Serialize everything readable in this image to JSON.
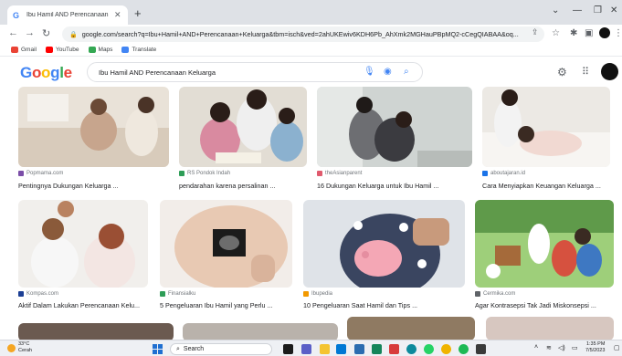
{
  "browser": {
    "tab_title": "Ibu Hamil AND Perencanaan Kel",
    "tab_favicon": "G",
    "new_tab": "+",
    "url": "google.com/search?q=Ibu+Hamil+AND+Perencanaan+Keluarga&tbm=isch&ved=2ahUKEwiv6KDH6Pb_AhXmk2MGHauPBpMQ2-cCegQIABAA&oq...",
    "bookmarks": [
      {
        "label": "Gmail",
        "icon": "gmail-icon",
        "color": "#ea4335"
      },
      {
        "label": "YouTube",
        "icon": "youtube-icon",
        "color": "#ff0000"
      },
      {
        "label": "Maps",
        "icon": "maps-icon",
        "color": "#34a853"
      },
      {
        "label": "Translate",
        "icon": "translate-icon",
        "color": "#4285f4"
      }
    ]
  },
  "google": {
    "logo": "Google",
    "query": "Ibu Hamil AND Perencanaan Keluarga",
    "colors": [
      "#4285f4",
      "#ea4335",
      "#fbbc05",
      "#4285f4",
      "#34a853",
      "#ea4335"
    ]
  },
  "results": [
    {
      "source": "Popmama.com",
      "title": "Pentingnya Dukungan Keluarga ...",
      "icon_color": "#7b4ea8"
    },
    {
      "source": "RS Pondok Indah",
      "title": "pendarahan karena persalinan ...",
      "icon_color": "#2e9d57"
    },
    {
      "source": "theAsianparent",
      "title": "16 Dukungan Keluarga untuk Ibu Hamil ...",
      "icon_color": "#e05a6d"
    },
    {
      "source": "aboutajaran.id",
      "title": "Cara Menyiapkan Keuangan Keluarga ...",
      "icon_color": "#1a73e8"
    },
    {
      "source": "Kompas.com",
      "title": "Aktif Dalam Lakukan Perencanaan Kelu...",
      "icon_color": "#1c3f94"
    },
    {
      "source": "Finansialku",
      "title": "5 Pengeluaran Ibu Hamil yang Perlu ...",
      "icon_color": "#2e9d57"
    },
    {
      "source": "Ibupedia",
      "title": "10 Pengeluaran Saat Hamil dan Tips ...",
      "icon_color": "#f29900"
    },
    {
      "source": "Cermika.com",
      "title": "Agar Kontrasepsi Tak Jadi Miskonsepsi ...",
      "icon_color": "#5f6368"
    }
  ],
  "taskbar": {
    "temperature": "33°C",
    "weather": "Cerah",
    "search_label": "Search",
    "time": "1:35 PM",
    "date": "7/5/2023"
  }
}
